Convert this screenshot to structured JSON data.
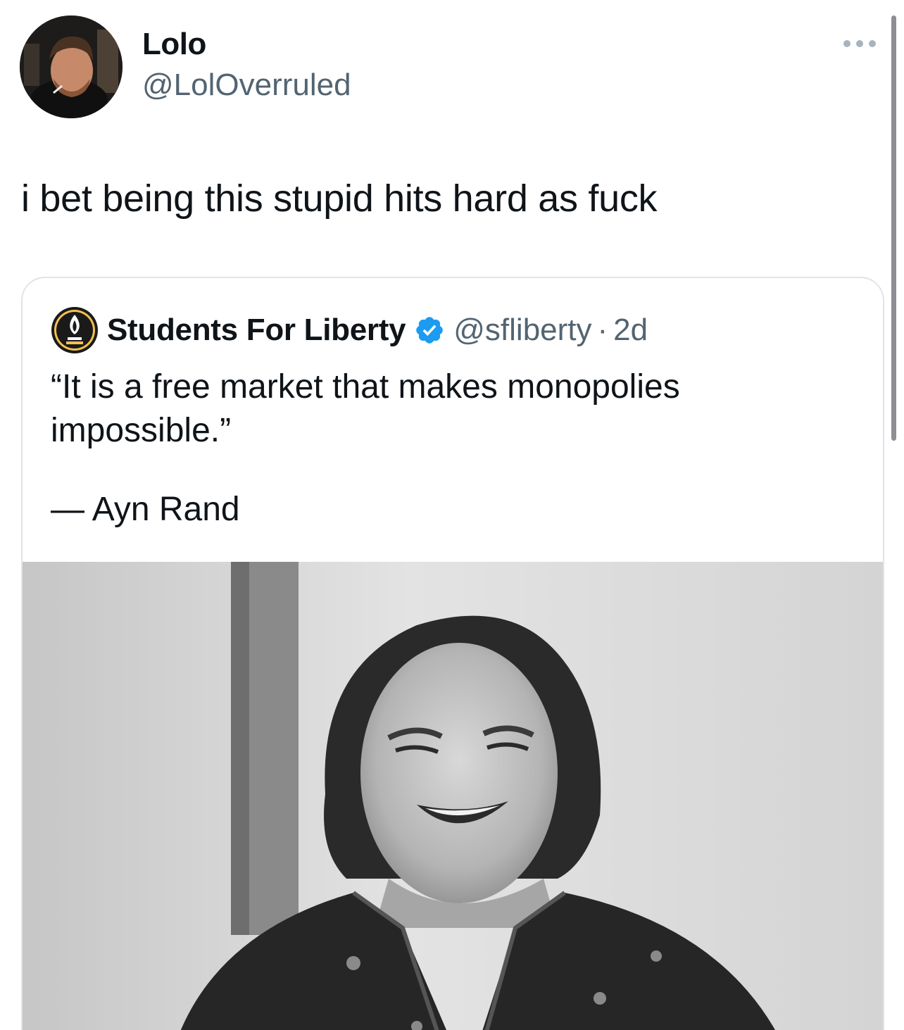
{
  "tweet": {
    "author": {
      "name": "Lolo",
      "handle": "@LolOverruled"
    },
    "text": "i bet being this stupid hits hard as fuck",
    "more_icon": "more-horizontal-icon"
  },
  "quoted_tweet": {
    "author": {
      "name": "Students For Liberty",
      "handle": "@sfliberty",
      "verified": true
    },
    "separator": "·",
    "time": "2d",
    "quote_line": "“It is a free market that makes monopolies impossible.”",
    "attribution": "— Ayn Rand",
    "media_alt": "black-and-white photo of a smiling woman"
  },
  "colors": {
    "text": "#0f1419",
    "secondary": "#536471",
    "verified": "#1d9bf0",
    "border": "#dfe4e8"
  }
}
